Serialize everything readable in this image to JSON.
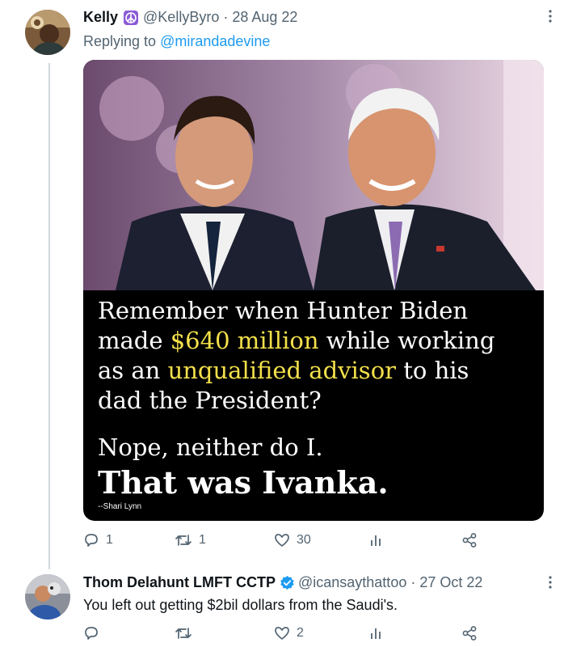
{
  "tweet1": {
    "name": "Kelly",
    "handle": "@KellyByro",
    "separator": "·",
    "date": "28 Aug 22",
    "reply_prefix": "Replying to",
    "reply_to": "@mirandadevine",
    "media": {
      "line1": "Remember when Hunter Biden",
      "line2_pre": "made ",
      "line2_hl": "$640 million",
      "line2_post": " while working",
      "line3_pre": "as an ",
      "line3_hl": "unqualified advisor",
      "line3_post": " to his",
      "line4": "dad the President?",
      "line5": "Nope, neither do I.",
      "line6": "That was Ivanka.",
      "credit": "--Shari Lynn"
    },
    "actions": {
      "replies": "1",
      "retweets": "1",
      "likes": "30"
    }
  },
  "tweet2": {
    "name": "Thom Delahunt LMFT CCTP",
    "handle": "@icansaythattoo",
    "separator": "·",
    "date": "27 Oct 22",
    "text": "You left out getting $2bil dollars from the Saudi's.",
    "actions": {
      "likes": "2"
    }
  },
  "icons": [
    "peace-emoji-icon",
    "more-icon",
    "reply-icon",
    "retweet-icon",
    "like-icon",
    "analytics-icon",
    "share-icon",
    "verified-badge-icon"
  ],
  "colors": {
    "link": "#1d9bf0",
    "muted": "#536471",
    "highlight": "#f3e04b",
    "thread_line": "#cfd9de"
  }
}
